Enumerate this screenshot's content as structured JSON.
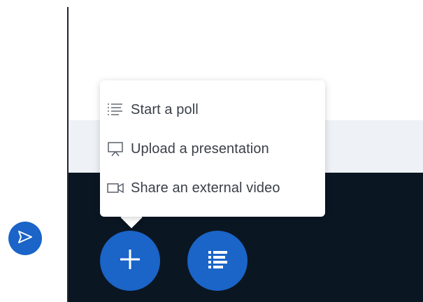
{
  "popup_menu": {
    "items": [
      {
        "label": "Start a poll",
        "icon": "poll-list-icon"
      },
      {
        "label": "Upload a presentation",
        "icon": "presentation-icon"
      },
      {
        "label": "Share an external video",
        "icon": "video-camera-icon"
      }
    ]
  },
  "colors": {
    "accent": "#1b64c8",
    "dark_background": "#0a1622",
    "gray_band": "#eef2f6",
    "menu_text": "#3a3f47"
  },
  "icons": {
    "send": "send-arrow-icon",
    "plus": "plus-icon",
    "list": "list-icon"
  }
}
